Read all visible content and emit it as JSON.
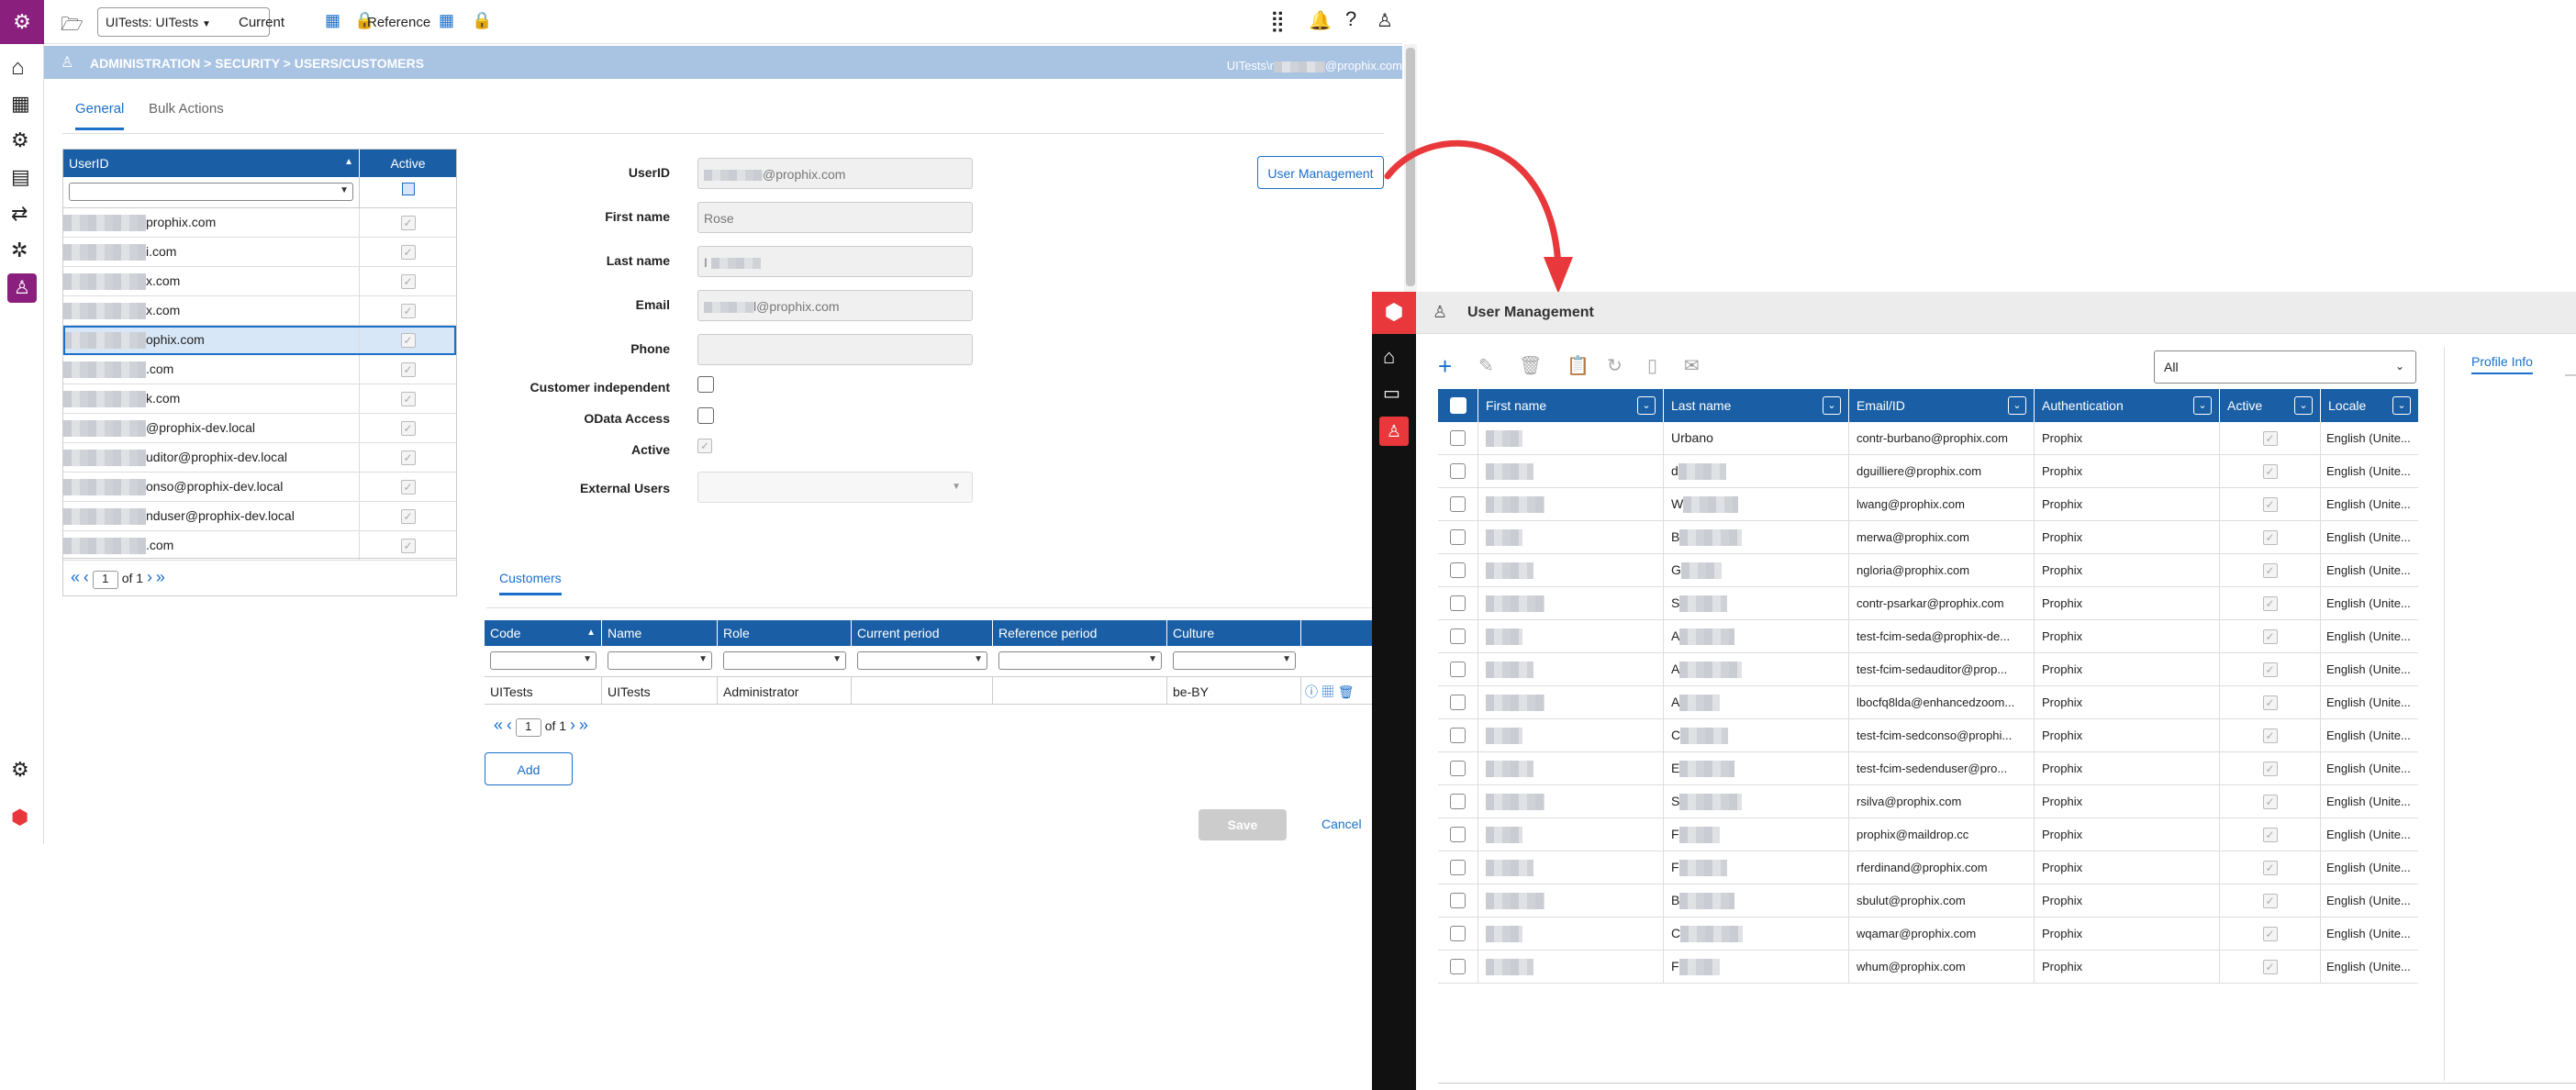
{
  "topbar": {
    "app_selector": "UITests: UITests",
    "current_label": "Current",
    "reference_label": "Reference"
  },
  "left_page": {
    "breadcrumb": "ADMINISTRATION > SECURITY > USERS/CUSTOMERS",
    "user_prefix": "UITests\\r",
    "user_suffix": "@prophix.com",
    "tabs": [
      "General",
      "Bulk Actions"
    ],
    "userlist": {
      "col_userid": "UserID",
      "col_active": "Active",
      "rows": [
        {
          "visible": "prophix.com",
          "blur": 90
        },
        {
          "visible": "i.com",
          "blur": 90
        },
        {
          "visible": "x.com",
          "blur": 90
        },
        {
          "visible": "x.com",
          "blur": 90
        },
        {
          "visible": "ophix.com",
          "blur": 90
        },
        {
          "visible": ".com",
          "blur": 90
        },
        {
          "visible": "k.com",
          "blur": 90
        },
        {
          "visible": "@prophix-dev.local",
          "blur": 90
        },
        {
          "visible": "uditor@prophix-dev.local",
          "blur": 90
        },
        {
          "visible": "onso@prophix-dev.local",
          "blur": 90
        },
        {
          "visible": "nduser@prophix-dev.local",
          "blur": 90
        },
        {
          "visible": ".com",
          "blur": 90
        }
      ],
      "page": "1",
      "of": "of 1"
    },
    "form": {
      "userid_label": "UserID",
      "userid_value": "@prophix.com",
      "firstname_label": "First name",
      "firstname_value": "Rose",
      "lastname_label": "Last name",
      "lastname_value": "I",
      "email_label": "Email",
      "email_value": "l@prophix.com",
      "phone_label": "Phone",
      "customer_independent_label": "Customer independent",
      "odata_label": "OData Access",
      "active_label": "Active",
      "external_users_label": "External Users",
      "user_mgmt_button": "User Management"
    },
    "customers": {
      "tab": "Customers",
      "cols": [
        "Code",
        "Name",
        "Role",
        "Current period",
        "Reference period",
        "Culture"
      ],
      "row": [
        "UITests",
        "UITests",
        "Administrator",
        "",
        "",
        "be-BY"
      ],
      "page": "1",
      "of": "of 1",
      "add": "Add",
      "save": "Save",
      "cancel": "Cancel"
    }
  },
  "right_page": {
    "title": "User Management",
    "filter_value": "All",
    "side_tabs": [
      "Profile Info"
    ],
    "cols": [
      "First name",
      "Last name",
      "Email/ID",
      "Authentication",
      "Active",
      "Locale"
    ],
    "rows": [
      {
        "first": "",
        "last": "Urbano",
        "email": "contr-burbano@prophix.com",
        "auth": "Prophix",
        "locale": "English (Unite..."
      },
      {
        "first": "",
        "last": "d",
        "email": "dguilliere@prophix.com",
        "auth": "Prophix",
        "locale": "English (Unite..."
      },
      {
        "first": "",
        "last": "W",
        "email": "lwang@prophix.com",
        "auth": "Prophix",
        "locale": "English (Unite..."
      },
      {
        "first": "",
        "last": "B",
        "email": "merwa@prophix.com",
        "auth": "Prophix",
        "locale": "English (Unite..."
      },
      {
        "first": "",
        "last": "G",
        "email": "ngloria@prophix.com",
        "auth": "Prophix",
        "locale": "English (Unite..."
      },
      {
        "first": "",
        "last": "S",
        "email": "contr-psarkar@prophix.com",
        "auth": "Prophix",
        "locale": "English (Unite..."
      },
      {
        "first": "",
        "last": "A",
        "email": "test-fcim-seda@prophix-de...",
        "auth": "Prophix",
        "locale": "English (Unite..."
      },
      {
        "first": "",
        "last": "A",
        "email": "test-fcim-sedauditor@prop...",
        "auth": "Prophix",
        "locale": "English (Unite..."
      },
      {
        "first": "",
        "last": "A",
        "email": "lbocfq8lda@enhancedzoom...",
        "auth": "Prophix",
        "locale": "English (Unite..."
      },
      {
        "first": "",
        "last": "C",
        "email": "test-fcim-sedconso@prophi...",
        "auth": "Prophix",
        "locale": "English (Unite..."
      },
      {
        "first": "",
        "last": "E",
        "email": "test-fcim-sedenduser@pro...",
        "auth": "Prophix",
        "locale": "English (Unite..."
      },
      {
        "first": "",
        "last": "S",
        "email": "rsilva@prophix.com",
        "auth": "Prophix",
        "locale": "English (Unite..."
      },
      {
        "first": "",
        "last": "F",
        "email": "prophix@maildrop.cc",
        "auth": "Prophix",
        "locale": "English (Unite..."
      },
      {
        "first": "",
        "last": "F",
        "email": "rferdinand@prophix.com",
        "auth": "Prophix",
        "locale": "English (Unite..."
      },
      {
        "first": "",
        "last": "B",
        "email": "sbulut@prophix.com",
        "auth": "Prophix",
        "locale": "English (Unite..."
      },
      {
        "first": "",
        "last": "C",
        "email": "wqamar@prophix.com",
        "auth": "Prophix",
        "locale": "English (Unite..."
      },
      {
        "first": "",
        "last": "F",
        "email": "whum@prophix.com",
        "auth": "Prophix",
        "locale": "English (Unite..."
      }
    ]
  },
  "colors": {
    "accent": "#1a5fa5",
    "brand_purple": "#8a1f7d",
    "annotation_red": "#e8383b",
    "header_band": "#a9c3e3"
  }
}
